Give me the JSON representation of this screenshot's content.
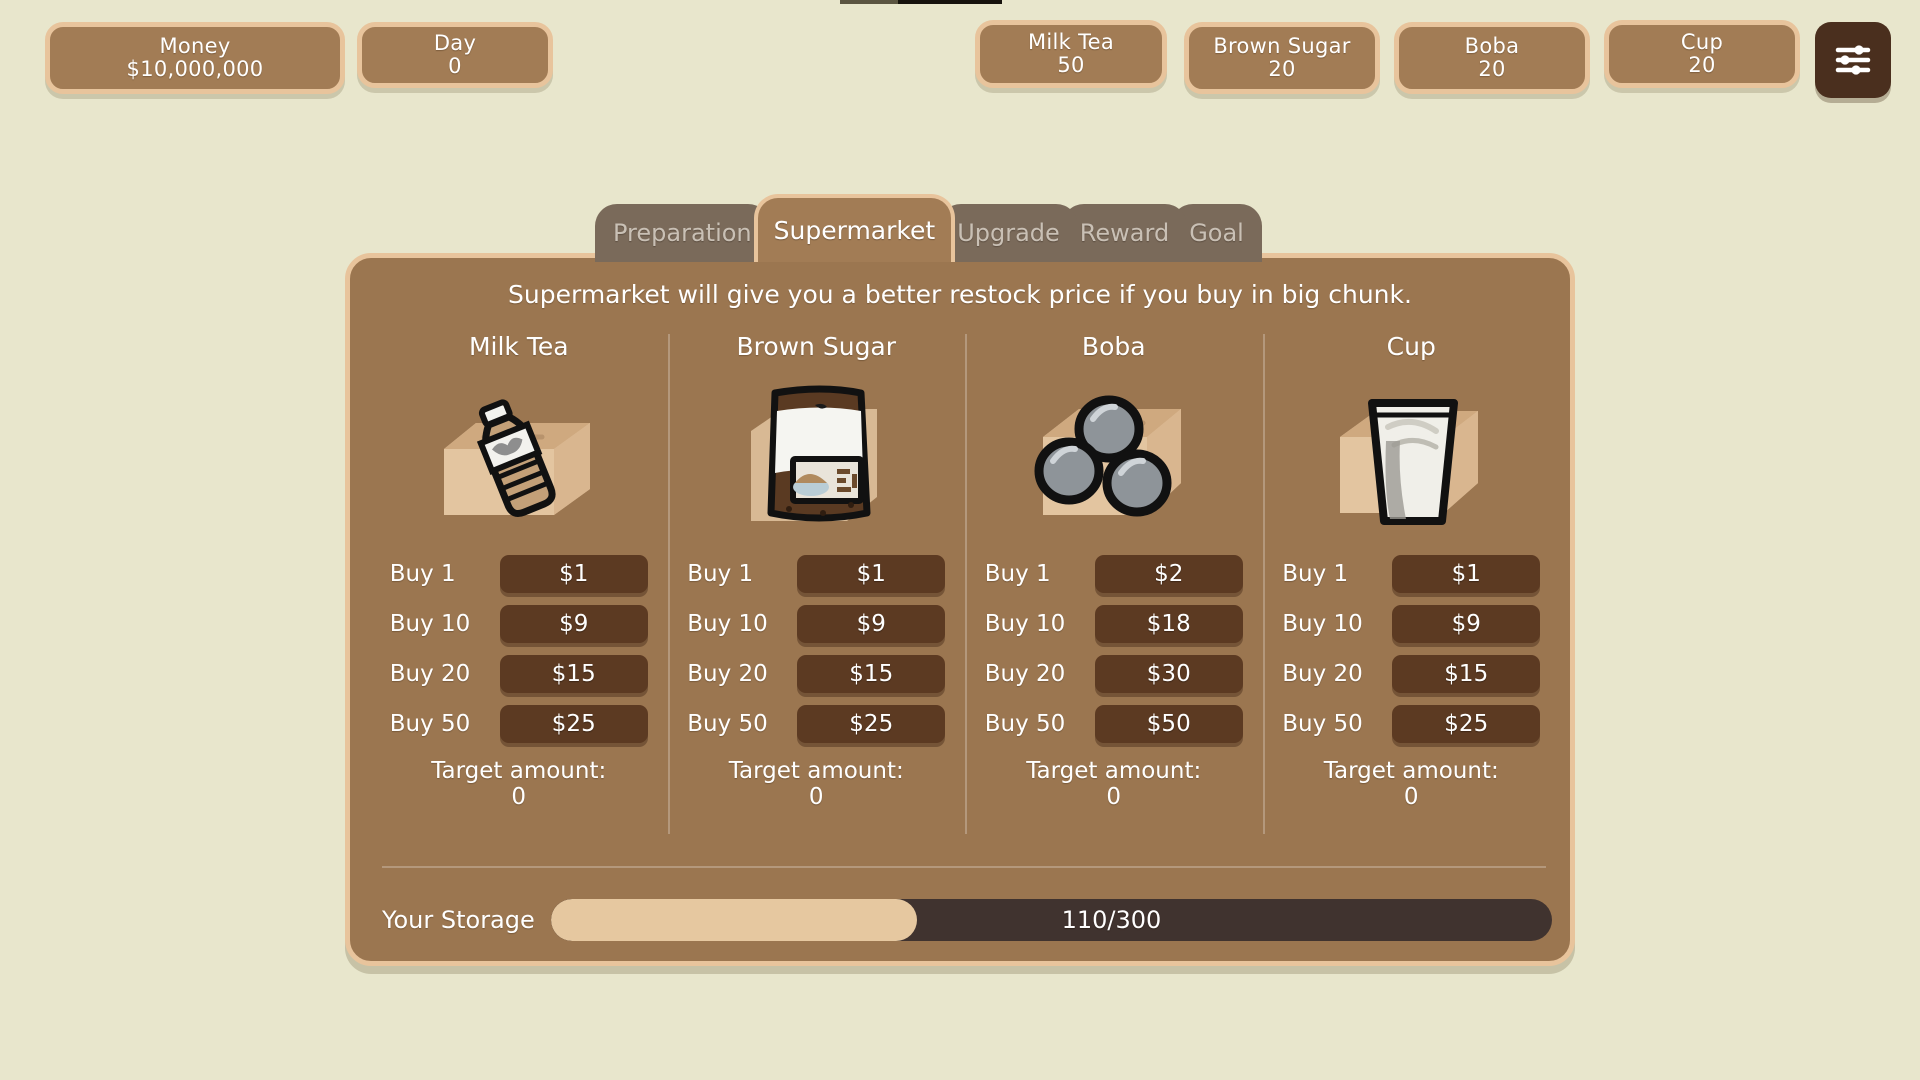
{
  "hud": {
    "stats": [
      {
        "id": "money",
        "label": "Money",
        "value": "$10,000,000"
      },
      {
        "id": "day",
        "label": "Day",
        "value": "0"
      }
    ],
    "resources": [
      {
        "id": "milktea",
        "label": "Milk Tea",
        "value": "50"
      },
      {
        "id": "sugar",
        "label": "Brown Sugar",
        "value": "20"
      },
      {
        "id": "boba",
        "label": "Boba",
        "value": "20"
      },
      {
        "id": "cup",
        "label": "Cup",
        "value": "20"
      }
    ],
    "settings_icon": "sliders-icon"
  },
  "tabs": [
    {
      "id": "preparation",
      "label": "Preparation",
      "active": false
    },
    {
      "id": "supermarket",
      "label": "Supermarket",
      "active": true
    },
    {
      "id": "upgrade",
      "label": "Upgrade",
      "active": false
    },
    {
      "id": "reward",
      "label": "Reward",
      "active": false
    },
    {
      "id": "goal",
      "label": "Goal",
      "active": false
    }
  ],
  "panel": {
    "subtitle": "Supermarket will give you a better restock price if you buy in big chunk.",
    "target_label": "Target amount:",
    "columns": [
      {
        "id": "milk-tea",
        "title": "Milk Tea",
        "art": "bottle-on-box-icon",
        "rows": [
          {
            "label": "Buy 1",
            "price": "$1"
          },
          {
            "label": "Buy 10",
            "price": "$9"
          },
          {
            "label": "Buy 20",
            "price": "$15"
          },
          {
            "label": "Buy 50",
            "price": "$25"
          }
        ],
        "target_amount": "0"
      },
      {
        "id": "brown-sugar",
        "title": "Brown Sugar",
        "art": "sugar-bag-icon",
        "rows": [
          {
            "label": "Buy 1",
            "price": "$1"
          },
          {
            "label": "Buy 10",
            "price": "$9"
          },
          {
            "label": "Buy 20",
            "price": "$15"
          },
          {
            "label": "Buy 50",
            "price": "$25"
          }
        ],
        "target_amount": "0"
      },
      {
        "id": "boba",
        "title": "Boba",
        "art": "boba-pearls-on-box-icon",
        "rows": [
          {
            "label": "Buy 1",
            "price": "$2"
          },
          {
            "label": "Buy 10",
            "price": "$18"
          },
          {
            "label": "Buy 20",
            "price": "$30"
          },
          {
            "label": "Buy 50",
            "price": "$50"
          }
        ],
        "target_amount": "0"
      },
      {
        "id": "cup",
        "title": "Cup",
        "art": "cup-on-box-icon",
        "rows": [
          {
            "label": "Buy 1",
            "price": "$1"
          },
          {
            "label": "Buy 10",
            "price": "$9"
          },
          {
            "label": "Buy 20",
            "price": "$15"
          },
          {
            "label": "Buy 50",
            "price": "$25"
          }
        ],
        "target_amount": "0"
      }
    ],
    "storage": {
      "label": "Your Storage",
      "text": "110/300",
      "current": 110,
      "max": 300,
      "percent": 36.6
    }
  },
  "colors": {
    "background": "#e8e6cc",
    "panel": "#9b7650",
    "panel_border": "#e8c49c",
    "pill": "#a27c55",
    "tab_inactive": "#7a6a5a",
    "button": "#5c3a22",
    "settings": "#4a2f1e",
    "storage_fill": "#e6c8a0",
    "storage_track": "#40332f",
    "text": "#ffffff"
  }
}
